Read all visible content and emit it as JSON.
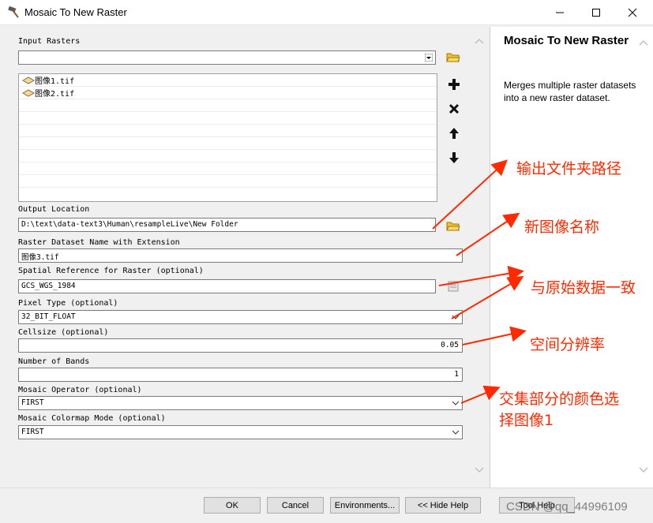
{
  "window": {
    "title": "Mosaic To New Raster",
    "controls": [
      "minimize-icon",
      "maximize-icon",
      "close-icon"
    ]
  },
  "form": {
    "input_rasters": {
      "label": "Input Rasters",
      "dropdown_value": "",
      "items": [
        "图像1.tif",
        "图像2.tif"
      ]
    },
    "output_location": {
      "label": "Output Location",
      "value": "D:\\text\\data-text3\\Human\\resampleLive\\New Folder"
    },
    "raster_name": {
      "label": "Raster Dataset Name with Extension",
      "value": "图像3.tif"
    },
    "spatial_reference": {
      "label": "Spatial Reference for Raster (optional)",
      "value": "GCS_WGS_1984"
    },
    "pixel_type": {
      "label": "Pixel Type (optional)",
      "value": "32_BIT_FLOAT"
    },
    "cellsize": {
      "label": "Cellsize (optional)",
      "value": "0.05"
    },
    "bands": {
      "label": "Number of Bands",
      "value": "1"
    },
    "mosaic_operator": {
      "label": "Mosaic Operator (optional)",
      "value": "FIRST"
    },
    "colormap_mode": {
      "label": "Mosaic Colormap Mode (optional)",
      "value": "FIRST"
    }
  },
  "help": {
    "title": "Mosaic To New Raster",
    "body": "Merges multiple raster datasets into a new raster dataset."
  },
  "buttons": {
    "ok": "OK",
    "cancel": "Cancel",
    "environments": "Environments...",
    "hide_help": "<< Hide Help",
    "tool_help": "Tool Help"
  },
  "annotations": {
    "output_folder": "输出文件夹路径",
    "new_name": "新图像名称",
    "same_as_original": "与原始数据一致",
    "spatial_resolution": "空间分辨率",
    "overlap_color_line1": "交集部分的颜色选",
    "overlap_color_line2": "择图像1"
  },
  "watermark": "CSDN @qq_44996109",
  "colors": {
    "annotation": "#ff2a00",
    "panel": "#f0f0f0",
    "field_border": "#7a7a7a"
  }
}
